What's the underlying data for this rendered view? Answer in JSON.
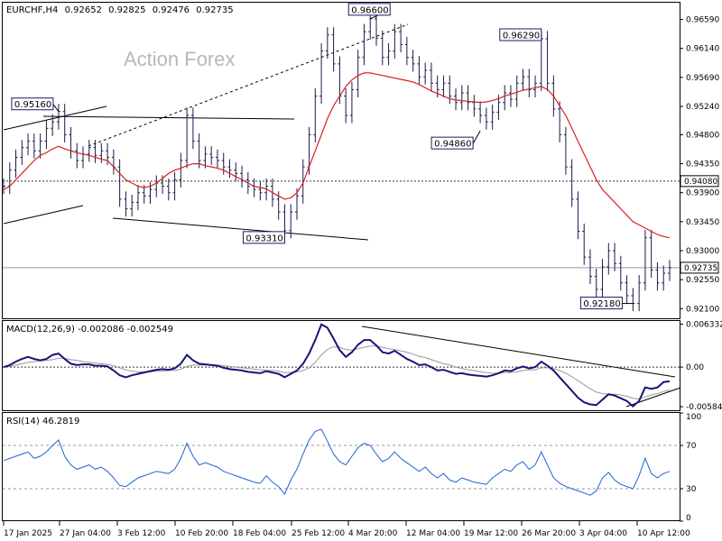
{
  "chart_data": {
    "type": "line",
    "symbol_title": "EURCHF,H4",
    "ohlc": [
      "0.92652",
      "0.92825",
      "0.92476",
      "0.92735"
    ],
    "watermark": "Action Forex",
    "x_ticks": [
      "17 Jan 2025",
      "27 Jan 04:00",
      "3 Feb 12:00",
      "10 Feb 20:00",
      "18 Feb 04:00",
      "25 Feb 12:00",
      "4 Mar 20:00",
      "12 Mar 04:00",
      "19 Mar 12:00",
      "26 Mar 20:00",
      "3 Apr 04:00",
      "10 Apr 12:00"
    ],
    "price_panel": {
      "ylim": [
        0.9195,
        0.9685
      ],
      "y_ticks": [
        "0.96590",
        "0.96140",
        "0.95690",
        "0.95240",
        "0.94800",
        "0.94350",
        "0.93900",
        "0.93450",
        "0.93000",
        "0.92550",
        "0.92100"
      ],
      "last_price": "0.92735",
      "level_line": "0.94080",
      "annotations": [
        {
          "text": "0.95160",
          "value": 0.9516
        },
        {
          "text": "0.96600",
          "value": 0.966
        },
        {
          "text": "0.96290",
          "value": 0.9629
        },
        {
          "text": "0.94860",
          "value": 0.9486
        },
        {
          "text": "0.93310",
          "value": 0.9331
        },
        {
          "text": "0.92180",
          "value": 0.9218
        }
      ],
      "close_series": [
        0.94,
        0.9425,
        0.9445,
        0.946,
        0.947,
        0.9455,
        0.947,
        0.949,
        0.95,
        0.9516,
        0.948,
        0.9455,
        0.944,
        0.945,
        0.946,
        0.9448,
        0.9455,
        0.9445,
        0.943,
        0.938,
        0.9365,
        0.9375,
        0.939,
        0.9385,
        0.9395,
        0.9405,
        0.94,
        0.939,
        0.941,
        0.944,
        0.951,
        0.947,
        0.944,
        0.945,
        0.9445,
        0.944,
        0.943,
        0.9425,
        0.942,
        0.941,
        0.94,
        0.9395,
        0.939,
        0.94,
        0.938,
        0.936,
        0.9331,
        0.936,
        0.9385,
        0.943,
        0.948,
        0.954,
        0.961,
        0.9635,
        0.959,
        0.954,
        0.951,
        0.955,
        0.96,
        0.964,
        0.966,
        0.963,
        0.96,
        0.961,
        0.964,
        0.962,
        0.96,
        0.959,
        0.957,
        0.958,
        0.956,
        0.955,
        0.956,
        0.954,
        0.953,
        0.9545,
        0.953,
        0.952,
        0.951,
        0.95,
        0.9515,
        0.953,
        0.9545,
        0.9535,
        0.956,
        0.957,
        0.955,
        0.956,
        0.9629,
        0.956,
        0.952,
        0.948,
        0.943,
        0.938,
        0.933,
        0.929,
        0.926,
        0.924,
        0.9275,
        0.93,
        0.928,
        0.925,
        0.923,
        0.9218,
        0.925,
        0.932,
        0.927,
        0.925,
        0.9265,
        0.92735
      ],
      "ma_series": [
        0.9395,
        0.94,
        0.941,
        0.942,
        0.943,
        0.944,
        0.9448,
        0.9452,
        0.9458,
        0.9462,
        0.9458,
        0.9455,
        0.9452,
        0.945,
        0.9448,
        0.9445,
        0.9442,
        0.944,
        0.943,
        0.942,
        0.941,
        0.9405,
        0.94,
        0.9398,
        0.94,
        0.9405,
        0.9412,
        0.942,
        0.9425,
        0.9428,
        0.9432,
        0.9435,
        0.9435,
        0.9432,
        0.943,
        0.9428,
        0.9425,
        0.942,
        0.9415,
        0.941,
        0.9405,
        0.94,
        0.9398,
        0.9396,
        0.939,
        0.9385,
        0.938,
        0.9382,
        0.939,
        0.9405,
        0.943,
        0.9455,
        0.948,
        0.9505,
        0.9525,
        0.954,
        0.9555,
        0.9565,
        0.9572,
        0.9576,
        0.9576,
        0.9574,
        0.9572,
        0.957,
        0.9568,
        0.9566,
        0.9564,
        0.9562,
        0.9558,
        0.9553,
        0.9548,
        0.9544,
        0.954,
        0.9536,
        0.9534,
        0.9533,
        0.9532,
        0.9531,
        0.953,
        0.9531,
        0.9533,
        0.9536,
        0.954,
        0.9543,
        0.9546,
        0.9549,
        0.9551,
        0.9553,
        0.9555,
        0.955,
        0.954,
        0.9525,
        0.951,
        0.949,
        0.947,
        0.945,
        0.943,
        0.941,
        0.9395,
        0.9385,
        0.9375,
        0.9365,
        0.9355,
        0.9345,
        0.934,
        0.9335,
        0.933,
        0.9325,
        0.9322,
        0.932
      ]
    },
    "macd_panel": {
      "title": "MACD(12,26,9) -0.002086 -0.002549",
      "ylim": [
        -0.0065,
        0.0068
      ],
      "y_ticks": [
        "0.006332",
        "0.00",
        "-0.005845"
      ],
      "main": [
        0.0,
        0.0003,
        0.0008,
        0.0012,
        0.0015,
        0.0012,
        0.001,
        0.0012,
        0.0018,
        0.002,
        0.0012,
        0.0005,
        0.0003,
        0.0004,
        0.0004,
        0.0002,
        0.0002,
        0.0001,
        -0.0005,
        -0.0012,
        -0.0015,
        -0.0012,
        -0.001,
        -0.0008,
        -0.0006,
        -0.0004,
        -0.0003,
        -0.0004,
        -0.0002,
        0.0005,
        0.0018,
        0.001,
        0.0005,
        0.0004,
        0.0003,
        0.0002,
        -0.0001,
        -0.0003,
        -0.0004,
        -0.0005,
        -0.0007,
        -0.0008,
        -0.0009,
        -0.0006,
        -0.0008,
        -0.001,
        -0.0015,
        -0.001,
        -0.0005,
        0.0005,
        0.002,
        0.004,
        0.0063,
        0.0058,
        0.0042,
        0.0025,
        0.0015,
        0.0022,
        0.0033,
        0.004,
        0.004,
        0.0032,
        0.0022,
        0.002,
        0.0024,
        0.0018,
        0.0012,
        0.0008,
        0.0003,
        0.0004,
        0.0,
        -0.0005,
        -0.0004,
        -0.0007,
        -0.001,
        -0.0009,
        -0.0011,
        -0.0012,
        -0.0013,
        -0.0014,
        -0.0012,
        -0.0009,
        -0.0005,
        -0.0006,
        -0.0002,
        0.0001,
        -0.0002,
        0.0,
        0.0008,
        0.0002,
        -0.0005,
        -0.0015,
        -0.0025,
        -0.0035,
        -0.0045,
        -0.0052,
        -0.0055,
        -0.0056,
        -0.0048,
        -0.004,
        -0.0042,
        -0.0046,
        -0.005,
        -0.0058,
        -0.005,
        -0.003,
        -0.0032,
        -0.003,
        -0.0022,
        -0.0021
      ],
      "signal": [
        0.0,
        0.0001,
        0.0003,
        0.0005,
        0.0007,
        0.0008,
        0.0009,
        0.001,
        0.0011,
        0.0013,
        0.0013,
        0.0011,
        0.001,
        0.0008,
        0.0007,
        0.0006,
        0.0005,
        0.0004,
        0.0002,
        -0.0001,
        -0.0004,
        -0.0006,
        -0.0007,
        -0.0007,
        -0.0007,
        -0.0006,
        -0.0006,
        -0.0005,
        -0.0005,
        -0.0003,
        0.0001,
        0.0003,
        0.0003,
        0.0003,
        0.0003,
        0.0003,
        0.0002,
        0.0001,
        0.0,
        -0.0001,
        -0.0002,
        -0.0003,
        -0.0004,
        -0.0005,
        -0.0005,
        -0.0006,
        -0.0008,
        -0.0008,
        -0.0007,
        -0.0005,
        -0.0001,
        0.0007,
        0.0018,
        0.0026,
        0.003,
        0.0029,
        0.0026,
        0.0025,
        0.0027,
        0.0029,
        0.0031,
        0.0031,
        0.0029,
        0.0027,
        0.0026,
        0.0024,
        0.0022,
        0.0019,
        0.0016,
        0.0014,
        0.0011,
        0.0008,
        0.0005,
        0.0003,
        0.0,
        -0.0002,
        -0.0004,
        -0.0005,
        -0.0007,
        -0.0008,
        -0.0009,
        -0.0009,
        -0.0008,
        -0.0008,
        -0.0007,
        -0.0005,
        -0.0004,
        -0.0004,
        -0.0001,
        -0.0001,
        -0.0002,
        -0.0005,
        -0.0009,
        -0.0014,
        -0.002,
        -0.0026,
        -0.0032,
        -0.0037,
        -0.0039,
        -0.004,
        -0.004,
        -0.0041,
        -0.0043,
        -0.0046,
        -0.0047,
        -0.0044,
        -0.0041,
        -0.0039,
        -0.0036,
        -0.0034
      ]
    },
    "rsi_panel": {
      "title": "RSI(14) 46.2819",
      "ylim": [
        0,
        100
      ],
      "y_ticks": [
        "100",
        "70",
        "30",
        "0"
      ],
      "levels": [
        70,
        30
      ],
      "values": [
        56,
        58,
        60,
        62,
        64,
        58,
        60,
        64,
        70,
        75,
        60,
        52,
        48,
        50,
        52,
        48,
        50,
        46,
        40,
        33,
        32,
        36,
        40,
        42,
        44,
        46,
        45,
        44,
        48,
        58,
        72,
        60,
        52,
        54,
        52,
        50,
        46,
        44,
        42,
        40,
        38,
        36,
        35,
        42,
        36,
        32,
        25,
        38,
        48,
        62,
        75,
        83,
        85,
        74,
        62,
        55,
        52,
        60,
        68,
        72,
        70,
        62,
        55,
        58,
        64,
        58,
        54,
        50,
        46,
        50,
        44,
        40,
        44,
        38,
        36,
        40,
        38,
        36,
        35,
        34,
        40,
        44,
        48,
        46,
        52,
        55,
        48,
        52,
        64,
        52,
        40,
        35,
        32,
        30,
        28,
        26,
        24,
        28,
        40,
        45,
        38,
        34,
        32,
        30,
        42,
        58,
        44,
        40,
        44,
        46
      ]
    }
  }
}
